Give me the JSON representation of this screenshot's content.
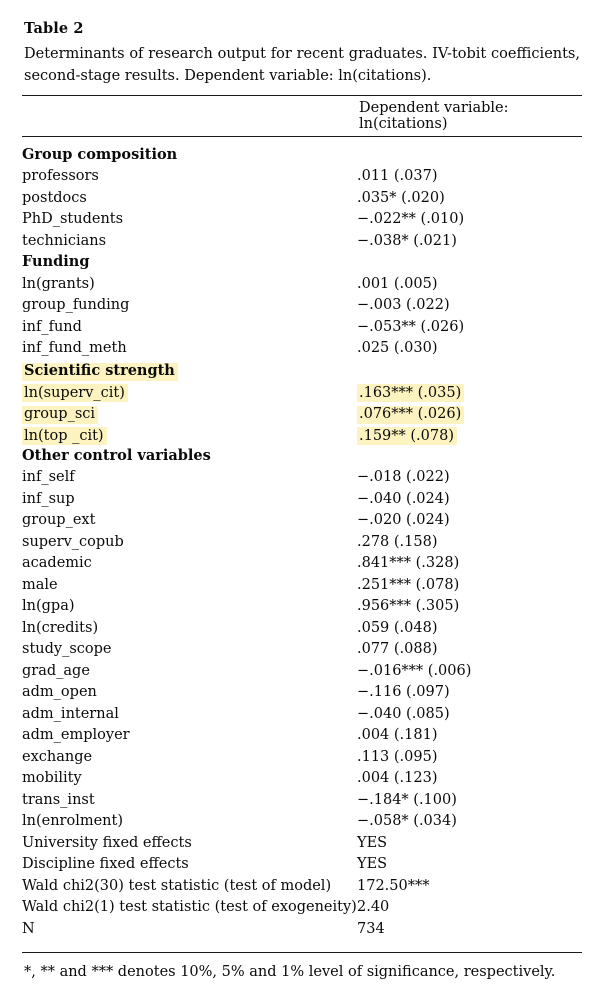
{
  "table": {
    "label": "Table 2",
    "caption": "Determinants of research output for recent graduates. IV-tobit coefficients, second-stage results. Dependent variable: ln(citations).",
    "column_header": "Dependent variable: ln(citations)",
    "footnote": "*, ** and *** denotes 10%, 5% and 1% level of significance, respectively.",
    "highlight_color": "#fdf3c0",
    "rows": [
      {
        "label": "Group composition",
        "value": "",
        "type": "section",
        "highlight": false
      },
      {
        "label": "professors",
        "value": ".011 (.037)",
        "type": "data",
        "highlight": false
      },
      {
        "label": "postdocs",
        "value": ".035* (.020)",
        "type": "data",
        "highlight": false
      },
      {
        "label": "PhD_students",
        "value": "−.022** (.010)",
        "type": "data",
        "highlight": false
      },
      {
        "label": "technicians",
        "value": "−.038* (.021)",
        "type": "data",
        "highlight": false
      },
      {
        "label": "Funding",
        "value": "",
        "type": "section",
        "highlight": false
      },
      {
        "label": "ln(grants)",
        "value": ".001 (.005)",
        "type": "data",
        "highlight": false
      },
      {
        "label": "group_funding",
        "value": "−.003 (.022)",
        "type": "data",
        "highlight": false
      },
      {
        "label": "inf_fund",
        "value": "−.053** (.026)",
        "type": "data",
        "highlight": false
      },
      {
        "label": "inf_fund_meth",
        "value": ".025 (.030)",
        "type": "data",
        "highlight": false
      },
      {
        "label": "Scientific strength",
        "value": "",
        "type": "section",
        "highlight": true
      },
      {
        "label": "ln(superv_cit)",
        "value": ".163*** (.035)",
        "type": "data",
        "highlight": true
      },
      {
        "label": "group_sci",
        "value": ".076*** (.026)",
        "type": "data",
        "highlight": true
      },
      {
        "label": "ln(top _cit)",
        "value": ".159** (.078)",
        "type": "data",
        "highlight": true
      },
      {
        "label": "Other control variables",
        "value": "",
        "type": "section",
        "highlight": false
      },
      {
        "label": "inf_self",
        "value": "−.018 (.022)",
        "type": "data",
        "highlight": false
      },
      {
        "label": "inf_sup",
        "value": "−.040 (.024)",
        "type": "data",
        "highlight": false
      },
      {
        "label": "group_ext",
        "value": "−.020 (.024)",
        "type": "data",
        "highlight": false
      },
      {
        "label": "superv_copub",
        "value": ".278 (.158)",
        "type": "data",
        "highlight": false
      },
      {
        "label": "academic",
        "value": ".841*** (.328)",
        "type": "data",
        "highlight": false
      },
      {
        "label": "male",
        "value": ".251*** (.078)",
        "type": "data",
        "highlight": false
      },
      {
        "label": "ln(gpa)",
        "value": ".956*** (.305)",
        "type": "data",
        "highlight": false
      },
      {
        "label": "ln(credits)",
        "value": ".059 (.048)",
        "type": "data",
        "highlight": false
      },
      {
        "label": "study_scope",
        "value": ".077 (.088)",
        "type": "data",
        "highlight": false
      },
      {
        "label": "grad_age",
        "value": "−.016*** (.006)",
        "type": "data",
        "highlight": false
      },
      {
        "label": "adm_open",
        "value": "−.116 (.097)",
        "type": "data",
        "highlight": false
      },
      {
        "label": "adm_internal",
        "value": "−.040 (.085)",
        "type": "data",
        "highlight": false
      },
      {
        "label": "adm_employer",
        "value": ".004 (.181)",
        "type": "data",
        "highlight": false
      },
      {
        "label": "exchange",
        "value": ".113 (.095)",
        "type": "data",
        "highlight": false
      },
      {
        "label": "mobility",
        "value": ".004 (.123)",
        "type": "data",
        "highlight": false
      },
      {
        "label": "trans_inst",
        "value": "−.184* (.100)",
        "type": "data",
        "highlight": false
      },
      {
        "label": "ln(enrolment)",
        "value": "−.058* (.034)",
        "type": "data",
        "highlight": false
      },
      {
        "label": "University fixed effects",
        "value": "YES",
        "type": "data",
        "highlight": false
      },
      {
        "label": "Discipline fixed effects",
        "value": "YES",
        "type": "data",
        "highlight": false
      },
      {
        "label": "Wald chi2(30) test statistic (test of model)",
        "value": "172.50***",
        "type": "data",
        "highlight": false
      },
      {
        "label": "Wald chi2(1) test statistic (test of exogeneity)",
        "value": "2.40",
        "type": "data",
        "highlight": false
      },
      {
        "label": "N",
        "value": "734",
        "type": "data",
        "highlight": false
      }
    ]
  }
}
